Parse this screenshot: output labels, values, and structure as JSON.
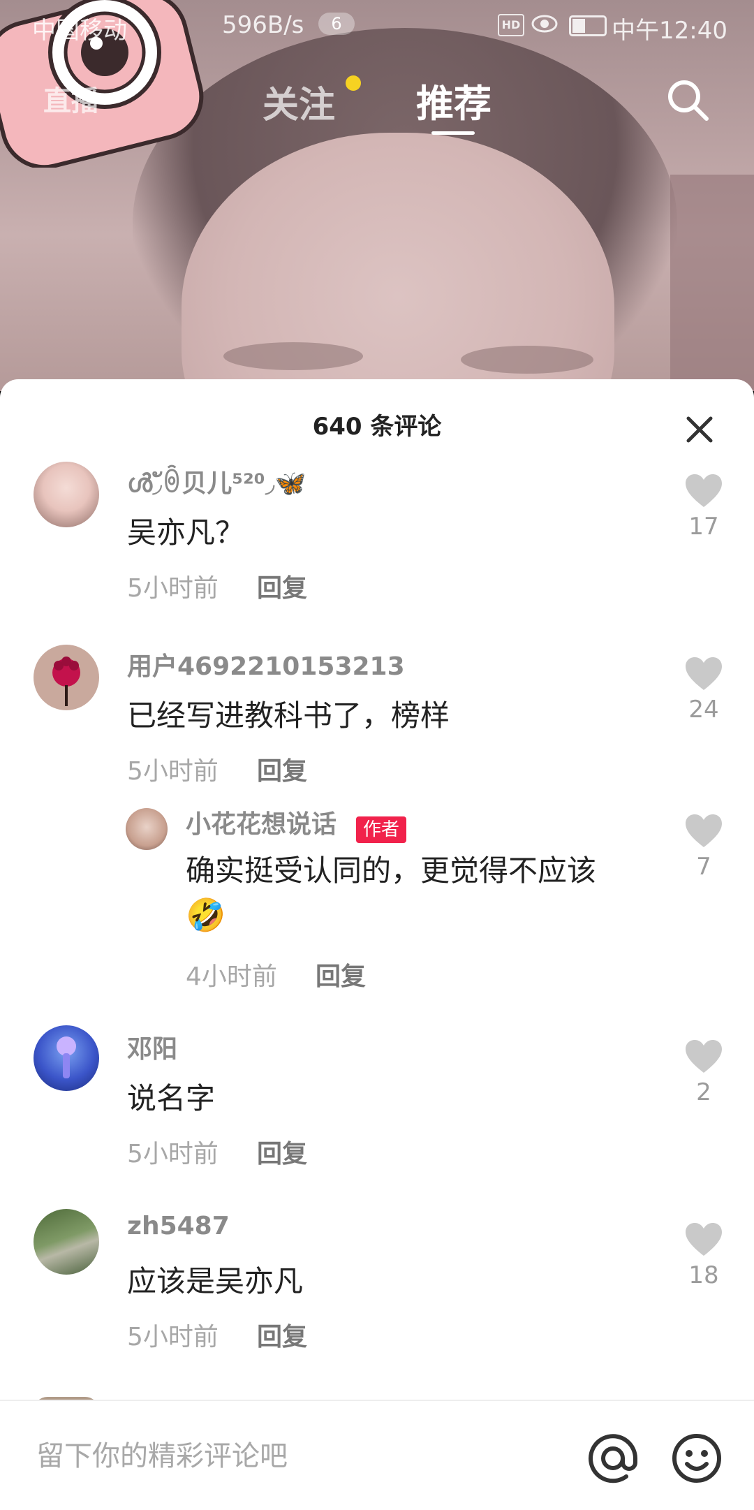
{
  "status_bar": {
    "carrier": "中国移动",
    "speed": "596B/s",
    "notification_count": "6",
    "hd": "HD",
    "time": "中午12:40"
  },
  "nav": {
    "live": "直播",
    "follow": "关注",
    "recommend": "推荐"
  },
  "comments_panel": {
    "title": "640 条评论",
    "comments": [
      {
        "username": "ൾ◞ัꉺ贝儿⁵²⁰◞🦋",
        "text": "吴亦凡？",
        "time": "5小时前",
        "reply": "回复",
        "likes": "17"
      },
      {
        "username": "用户4692210153213",
        "text": "已经写进教科书了，榜样",
        "time": "5小时前",
        "reply": "回复",
        "likes": "24"
      },
      {
        "username": "邓阳",
        "text": "说名字",
        "time": "5小时前",
        "reply": "回复",
        "likes": "2"
      },
      {
        "username": "zh5487",
        "text": "应该是吴亦凡",
        "time": "5小时前",
        "reply": "回复",
        "likes": "18"
      }
    ],
    "reply": {
      "username": "小花花想说话",
      "tag": "作者",
      "text": "确实挺受认同的，更觉得不应该",
      "emoji": "🤣",
      "time": "4小时前",
      "reply": "回复",
      "likes": "7"
    }
  },
  "input_bar": {
    "placeholder": "留下你的精彩评论吧"
  }
}
